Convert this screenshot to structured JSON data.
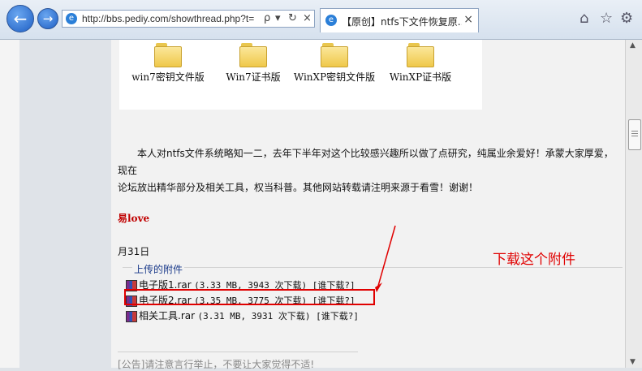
{
  "browser": {
    "url": "http://bbs.pediy.com/showthread.php?t=",
    "tab_title": "【原创】ntfs下文件恢复原...",
    "tab_close": "×",
    "address_controls": [
      "ρ",
      "▾",
      "↻",
      "×"
    ]
  },
  "folders": [
    {
      "label": "win7密钥文件版"
    },
    {
      "label": "Win7证书版"
    },
    {
      "label": "WinXP密钥文件版"
    },
    {
      "label": "WinXP证书版"
    }
  ],
  "post": {
    "paragraph_line1": "本人对ntfs文件系统略知一二，去年下半年对这个比较感兴趣所以做了点研究，纯属业余爱好！承蒙大家厚爱，现在",
    "paragraph_line2": "论坛放出精华部分及相关工具，权当科普。其他网站转载请注明来源于看雪！谢谢！",
    "signature": "易love",
    "date": "月31日"
  },
  "attachments": {
    "title": "上传的附件",
    "items": [
      {
        "name": "电子版1.rar",
        "meta": "(3.33 MB, 3943 次下载) [谁下载?]"
      },
      {
        "name": "电子版2.rar",
        "meta": "(3.35 MB, 3775 次下载) [谁下载?]"
      },
      {
        "name": "相关工具.rar",
        "meta": "(3.31 MB, 3931 次下载) [谁下载?]"
      }
    ]
  },
  "notice": "[公告]请注意言行举止，不要让大家觉得不适!",
  "annotation": "下载这个附件",
  "colors": {
    "highlight": "#e00000",
    "signature": "#c00000"
  }
}
